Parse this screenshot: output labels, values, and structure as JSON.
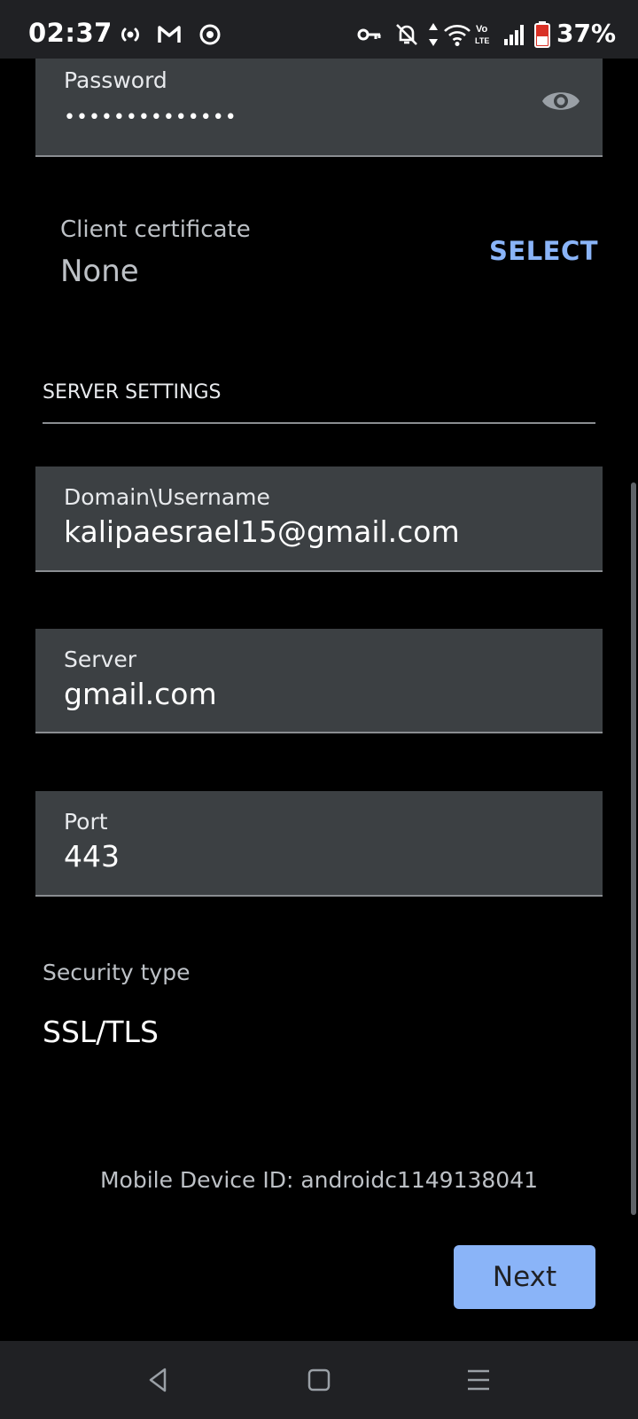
{
  "status_bar": {
    "time": "02:37",
    "battery_percent": "37%",
    "icons": [
      "hotspot-icon",
      "gmail-icon",
      "sync-icon",
      "vpn-key-icon",
      "notifications-off-icon",
      "data-arrows-icon",
      "wifi-icon",
      "volte-icon",
      "signal-icon",
      "battery-icon"
    ]
  },
  "password_field": {
    "label": "Password",
    "value_masked": "••••••••••••••"
  },
  "client_certificate": {
    "label": "Client certificate",
    "value": "None",
    "select_label": "SELECT"
  },
  "server_settings": {
    "title": "SERVER SETTINGS",
    "domain_username": {
      "label": "Domain\\Username",
      "value": "kalipaesrael15@gmail.com"
    },
    "server": {
      "label": "Server",
      "value": "gmail.com"
    },
    "port": {
      "label": "Port",
      "value": "443"
    }
  },
  "security_type": {
    "label": "Security type",
    "value": "SSL/TLS"
  },
  "device_id": "Mobile Device ID: androidc1149138041",
  "next_label": "Next",
  "colors": {
    "accent": "#8ab4f8",
    "field_bg": "#3c4043",
    "bar_bg": "#202124"
  }
}
